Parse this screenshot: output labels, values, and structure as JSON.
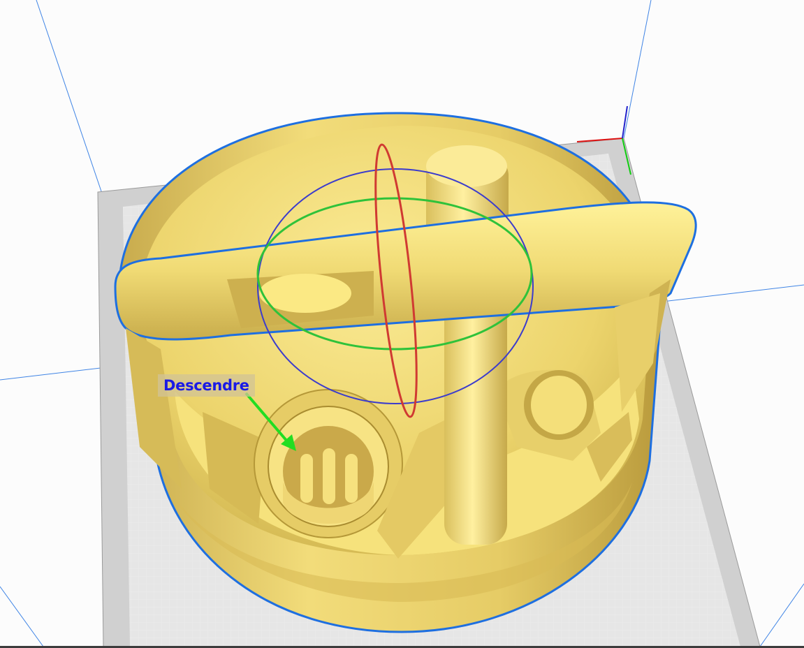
{
  "annotation": {
    "label": "Descendre"
  },
  "colors": {
    "model": "#f5e07a",
    "model_outline": "#1e6fe0",
    "build_plate": "#d2d2d2",
    "grid_line": "#ededed",
    "volume_edge": "#3f84e5",
    "rotate_x_ring": "#d03a32",
    "rotate_y_ring": "#2fc23a",
    "rotate_z_ring": "#3c3ccc",
    "arrow": "#22dd22",
    "label_text": "#1a1ae6"
  },
  "icons": [
    "axis-origin-icon",
    "arrow-icon"
  ]
}
